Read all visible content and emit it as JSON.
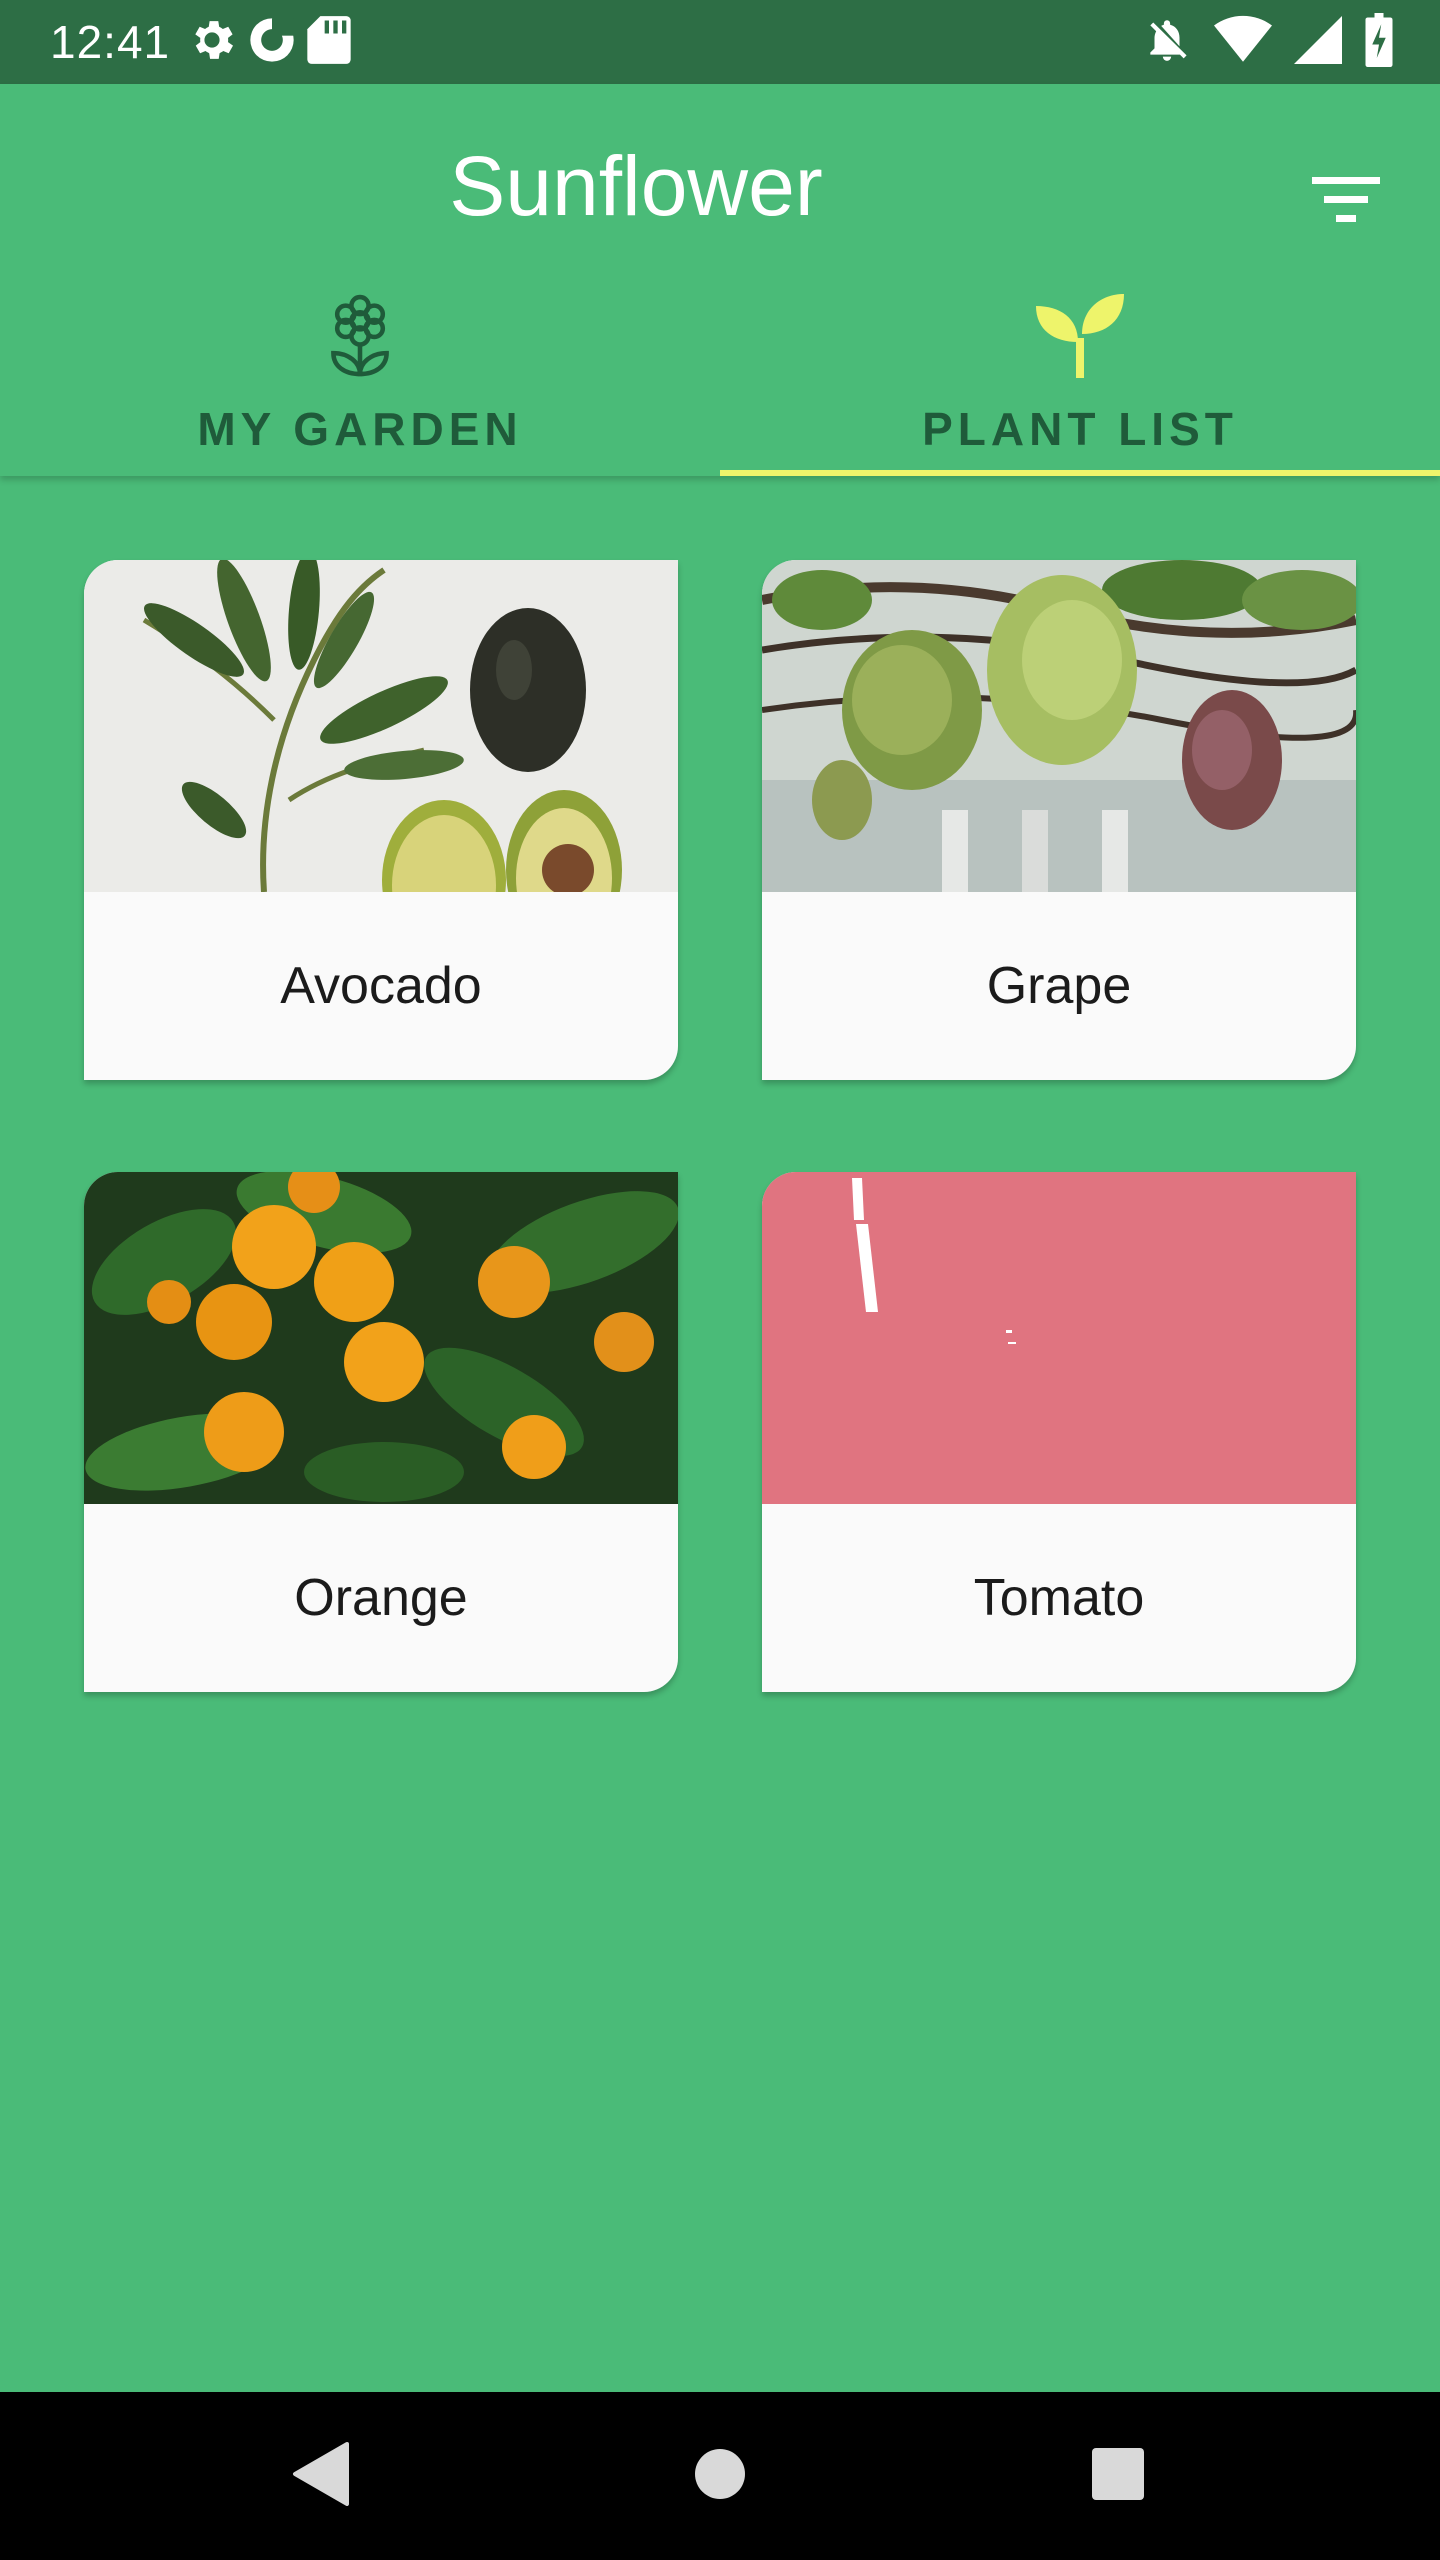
{
  "status_bar": {
    "time": "12:41",
    "left_icons": [
      "gear-icon",
      "sync-icon",
      "sd-card-icon"
    ],
    "right_icons": [
      "notifications-off-icon",
      "wifi-icon",
      "signal-icon",
      "battery-charging-icon"
    ]
  },
  "app_bar": {
    "title": "Sunflower",
    "filter_icon": "filter-icon"
  },
  "tabs": [
    {
      "label": "MY GARDEN",
      "icon": "flower-outline-icon",
      "selected": false
    },
    {
      "label": "PLANT LIST",
      "icon": "sprout-icon",
      "selected": true
    }
  ],
  "colors": {
    "primary": "#4abb78",
    "status_bar": "#2d6e45",
    "tab_text": "#1f5b3a",
    "accent": "#eef46b",
    "tomato_placeholder": "#e07480"
  },
  "plants": [
    {
      "name": "Avocado"
    },
    {
      "name": "Grape"
    },
    {
      "name": "Orange"
    },
    {
      "name": "Tomato"
    }
  ],
  "nav_bar": {
    "buttons": [
      "back-icon",
      "home-icon",
      "recents-icon"
    ]
  }
}
